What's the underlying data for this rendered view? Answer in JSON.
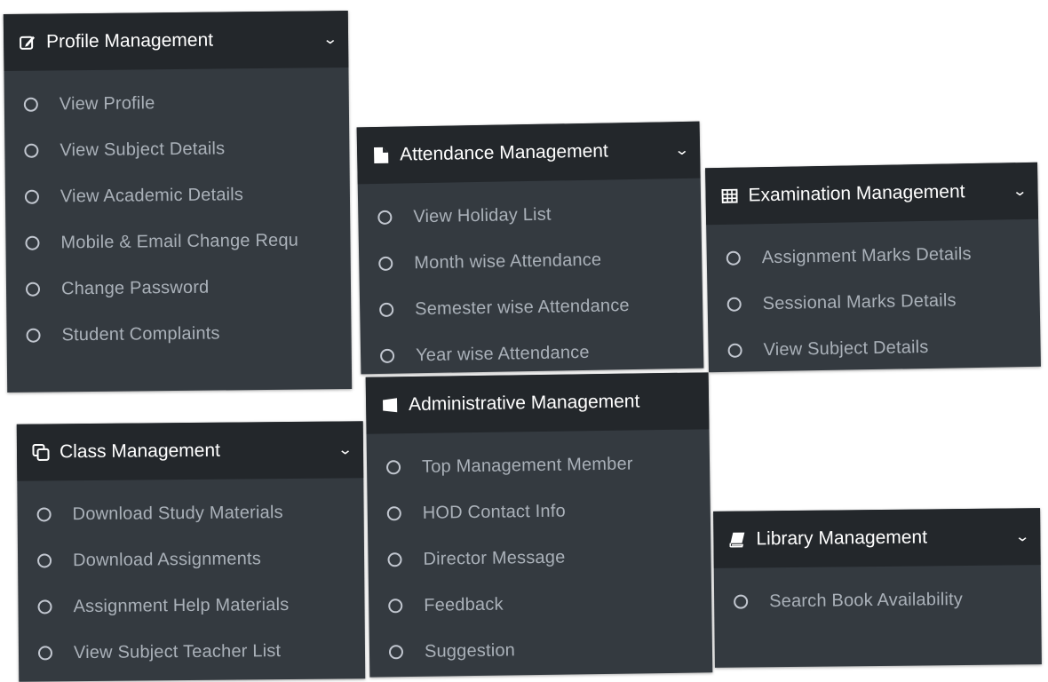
{
  "panels": [
    {
      "id": "profile",
      "title": "Profile Management",
      "icon": "edit-icon",
      "has_chevron": true,
      "items": [
        "View Profile",
        "View Subject Details",
        "View Academic Details",
        "Mobile & Email Change Requ",
        "Change Password",
        "Student Complaints"
      ]
    },
    {
      "id": "attendance",
      "title": "Attendance Management",
      "icon": "file-icon",
      "has_chevron": true,
      "items": [
        "View Holiday List",
        "Month wise Attendance",
        "Semester wise Attendance",
        "Year wise Attendance"
      ]
    },
    {
      "id": "examination",
      "title": "Examination Management",
      "icon": "table-icon",
      "has_chevron": true,
      "items": [
        "Assignment Marks Details",
        "Sessional Marks Details",
        "View Subject Details"
      ]
    },
    {
      "id": "class",
      "title": "Class Management",
      "icon": "copy-icon",
      "has_chevron": true,
      "items": [
        "Download Study Materials",
        "Download Assignments",
        "Assignment Help Materials",
        "View Subject Teacher List"
      ]
    },
    {
      "id": "administrative",
      "title": "Administrative Management",
      "icon": "windows-icon",
      "has_chevron": false,
      "items": [
        "Top Management Member",
        "HOD Contact Info",
        "Director Message",
        "Feedback",
        "Suggestion"
      ]
    },
    {
      "id": "library",
      "title": "Library Management",
      "icon": "book-icon",
      "has_chevron": true,
      "items": [
        "Search Book Availability"
      ]
    }
  ],
  "colors": {
    "panel_bg": "#343a40",
    "header_bg": "#23272b",
    "item_text": "#aab1b9"
  }
}
